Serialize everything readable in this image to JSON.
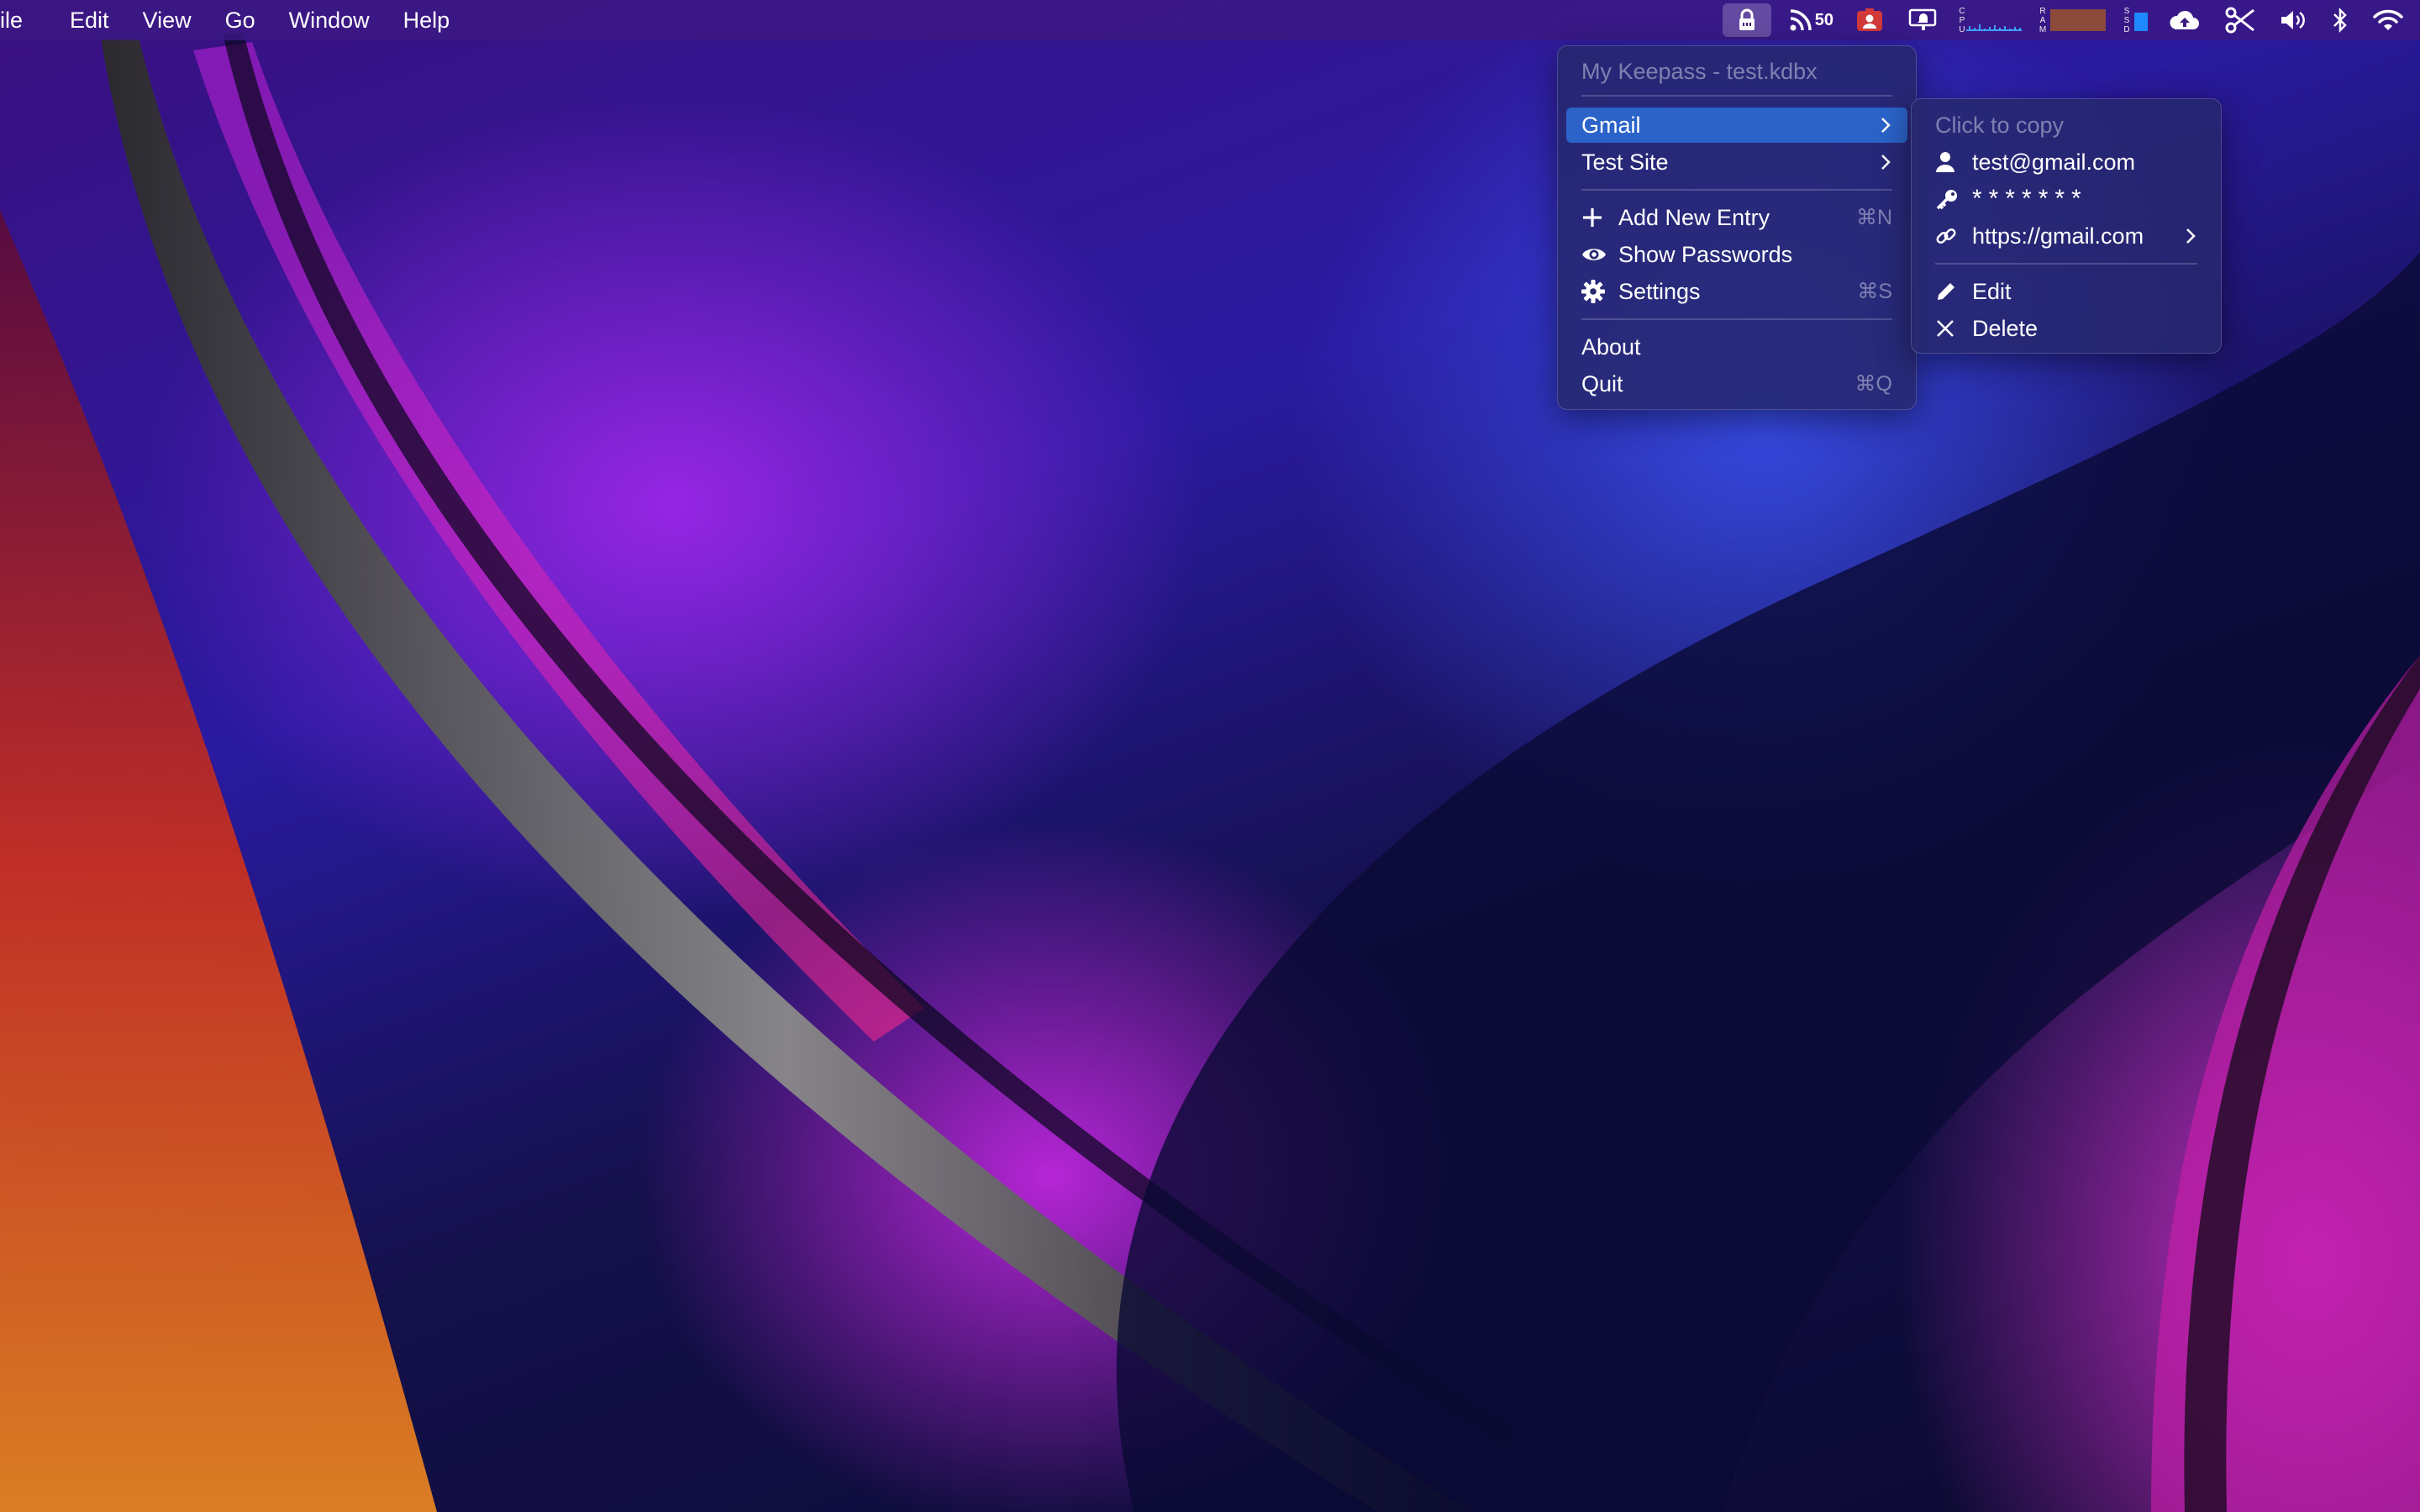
{
  "menubar": {
    "items": [
      "ile",
      "Edit",
      "View",
      "Go",
      "Window",
      "Help"
    ],
    "rss_count": "50",
    "cpu_label": "CPU",
    "ram_label": "RAM",
    "ssd_label": "SSD"
  },
  "main_menu": {
    "header": "My Keepass - test.kdbx",
    "entries": [
      "Gmail",
      "Test Site"
    ],
    "add_new_entry": {
      "label": "Add New Entry",
      "shortcut": "⌘N"
    },
    "show_passwords": {
      "label": "Show Passwords"
    },
    "settings": {
      "label": "Settings",
      "shortcut": "⌘S"
    },
    "about": {
      "label": "About"
    },
    "quit": {
      "label": "Quit",
      "shortcut": "⌘Q"
    }
  },
  "sub_menu": {
    "header": "Click to copy",
    "username": "test@gmail.com",
    "password": "*******",
    "url": "https://gmail.com",
    "edit": "Edit",
    "delete": "Delete"
  },
  "colors": {
    "highlight": "#2b63c9",
    "menubar": "#3c1982",
    "ram_bar": "#8b4a3a",
    "ssd_bar": "#1e88ff",
    "cpu_graph": "#3fa0ff"
  }
}
